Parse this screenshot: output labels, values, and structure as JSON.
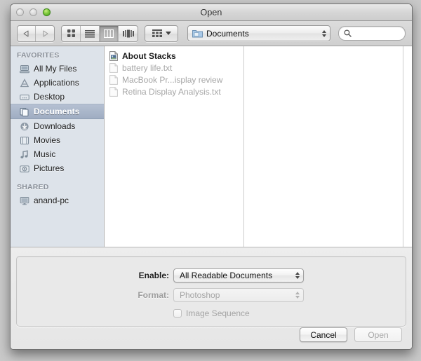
{
  "window": {
    "title": "Open",
    "traffic_lights": [
      {
        "name": "close-button",
        "color": "#d6d6d6",
        "state": "disabled"
      },
      {
        "name": "minimize-button",
        "color": "#d6d6d6",
        "state": "disabled"
      },
      {
        "name": "zoom-button",
        "color": "#7ec83c",
        "state": "enabled"
      }
    ]
  },
  "toolbar": {
    "back_icon": "back-arrow-icon",
    "forward_icon": "forward-arrow-icon",
    "view_modes": [
      {
        "label": "Icon View",
        "icon": "icon-view-icon",
        "selected": false
      },
      {
        "label": "List View",
        "icon": "list-view-icon",
        "selected": false
      },
      {
        "label": "Column View",
        "icon": "column-view-icon",
        "selected": true
      },
      {
        "label": "Cover Flow View",
        "icon": "coverflow-view-icon",
        "selected": false
      }
    ],
    "arrange": {
      "label": "Arrange By",
      "icon": "arrange-grid-icon"
    },
    "path_popup": {
      "label": "Documents",
      "icon": "folder-icon"
    },
    "search": {
      "value": "",
      "placeholder": "",
      "icon": "search-icon"
    }
  },
  "sidebar": {
    "groups": [
      {
        "title": "FAVORITES",
        "items": [
          {
            "label": "All My Files",
            "icon": "all-my-files-icon",
            "selected": false
          },
          {
            "label": "Applications",
            "icon": "applications-icon",
            "selected": false
          },
          {
            "label": "Desktop",
            "icon": "desktop-icon",
            "selected": false
          },
          {
            "label": "Documents",
            "icon": "documents-folder-icon",
            "selected": true
          },
          {
            "label": "Downloads",
            "icon": "downloads-icon",
            "selected": false
          },
          {
            "label": "Movies",
            "icon": "movies-icon",
            "selected": false
          },
          {
            "label": "Music",
            "icon": "music-note-icon",
            "selected": false
          },
          {
            "label": "Pictures",
            "icon": "pictures-camera-icon",
            "selected": false
          }
        ]
      },
      {
        "title": "SHARED",
        "items": [
          {
            "label": "anand-pc",
            "icon": "computer-display-icon",
            "selected": false
          }
        ]
      }
    ]
  },
  "file_list": {
    "items": [
      {
        "name": "About Stacks",
        "icon": "pdf-document-icon",
        "enabled": true
      },
      {
        "name": "battery life.txt",
        "icon": "text-document-icon",
        "enabled": false
      },
      {
        "name": "MacBook Pr...isplay review",
        "icon": "text-document-icon",
        "enabled": false
      },
      {
        "name": "Retina Display Analysis.txt",
        "icon": "text-document-icon",
        "enabled": false
      }
    ]
  },
  "options": {
    "enable": {
      "label": "Enable:",
      "value": "All Readable Documents",
      "disabled": false
    },
    "format": {
      "label": "Format:",
      "value": "Photoshop",
      "disabled": true
    },
    "image_sequence": {
      "label": "Image Sequence",
      "checked": false,
      "disabled": true
    }
  },
  "actions": {
    "cancel_label": "Cancel",
    "open_label": "Open"
  }
}
